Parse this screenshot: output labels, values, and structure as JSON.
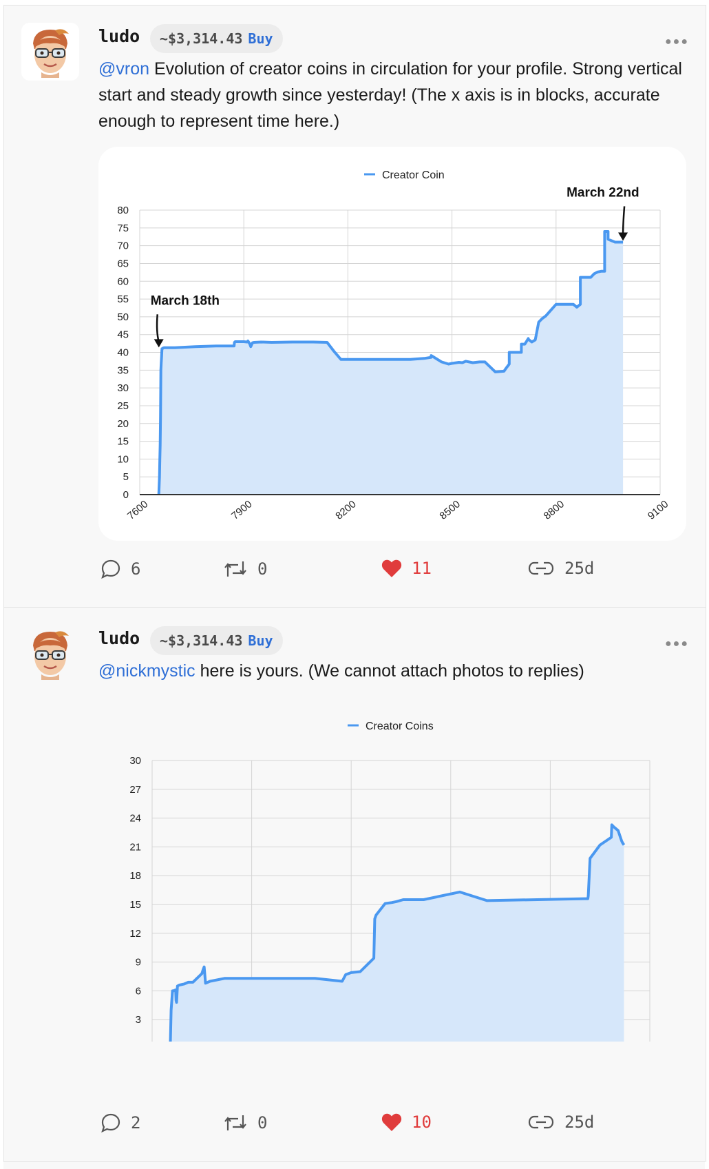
{
  "posts": [
    {
      "username": "ludo",
      "price": "~$3,314.43",
      "buy_label": "Buy",
      "mention": "@vron",
      "text": " Evolution of creator coins in circulation for your profile. Strong vertical start and steady growth since yesterday! (The x axis is in blocks, accurate enough to represent time here.)",
      "actions": {
        "comments": "6",
        "reposts": "0",
        "likes": "11",
        "age": "25d"
      }
    },
    {
      "username": "ludo",
      "price": "~$3,314.43",
      "buy_label": "Buy",
      "mention": "@nickmystic",
      "text": " here is yours. (We cannot attach photos to replies)",
      "actions": {
        "comments": "2",
        "reposts": "0",
        "likes": "10",
        "age": "25d"
      }
    }
  ],
  "colors": {
    "accent": "#2f6fd6",
    "like": "#e03c3c",
    "series": "#4a98f0",
    "fill": "#d6e7fa"
  },
  "chart_data": [
    {
      "type": "area",
      "legend": "Creator Coin",
      "xlim": [
        7600,
        9100
      ],
      "xticks": [
        7600,
        7900,
        8200,
        8500,
        8800,
        9100
      ],
      "ylim": [
        0,
        80
      ],
      "yticks": [
        0,
        5,
        10,
        15,
        20,
        25,
        30,
        35,
        40,
        45,
        50,
        55,
        60,
        65,
        70,
        75,
        80
      ],
      "grid": true,
      "legend_position": "top",
      "annotations": [
        {
          "text": "March 18th",
          "x": 7655,
          "y": 41
        },
        {
          "text": "March 22nd",
          "x": 8993,
          "y": 71
        }
      ],
      "series": [
        {
          "name": "Creator Coin",
          "x": [
            7655,
            7657,
            7658,
            7659,
            7660,
            7661,
            7662,
            7663,
            7664,
            7665,
            7667,
            7670,
            7700,
            7760,
            7820,
            7872,
            7873,
            7875,
            7900,
            7910,
            7912,
            7917,
            7920,
            7925,
            7930,
            7950,
            7980,
            8040,
            8100,
            8140,
            8160,
            8180,
            8200,
            8260,
            8380,
            8420,
            8440,
            8440,
            8470,
            8490,
            8500,
            8520,
            8530,
            8540,
            8560,
            8580,
            8595,
            8625,
            8650,
            8655,
            8665,
            8665,
            8700,
            8700,
            8710,
            8720,
            8720,
            8730,
            8740,
            8750,
            8760,
            8770,
            8770,
            8800,
            8800,
            8850,
            8860,
            8870,
            8870,
            8900,
            8910,
            8920,
            8930,
            8940,
            8940,
            8950,
            8950,
            8970,
            8975,
            8993
          ],
          "y": [
            0,
            5,
            10,
            14,
            22,
            35,
            37,
            39,
            41,
            41,
            41.2,
            41.3,
            41.3,
            41.6,
            41.8,
            41.8,
            42.8,
            43,
            43,
            42.9,
            43.2,
            42.4,
            41.6,
            42.7,
            42.8,
            42.9,
            42.8,
            42.9,
            42.9,
            42.8,
            40.3,
            38,
            38,
            38,
            38,
            38.3,
            38.6,
            39.1,
            37.3,
            36.7,
            36.9,
            37.2,
            37.1,
            37.5,
            37.1,
            37.3,
            37.3,
            34.5,
            34.7,
            35.4,
            36.7,
            40,
            40,
            42.3,
            42.3,
            43.9,
            43.7,
            42.9,
            43.5,
            48.5,
            49.5,
            50.2,
            50.2,
            53.5,
            53.5,
            53.5,
            52.7,
            53.5,
            61.1,
            61.1,
            62.1,
            62.6,
            62.8,
            62.8,
            74,
            74,
            71.8,
            71,
            71,
            71
          ]
        }
      ]
    },
    {
      "type": "area",
      "legend": "Creator Coins",
      "xlim": [
        8000,
        9100
      ],
      "xticks": [
        8000,
        8220,
        8440,
        8660,
        8880,
        9100
      ],
      "ylim": [
        0,
        30
      ],
      "yticks": [
        0,
        3,
        6,
        9,
        12,
        15,
        18,
        21,
        24,
        27,
        30
      ],
      "grid": true,
      "legend_position": "top",
      "series": [
        {
          "name": "Creator Coins",
          "x": [
            8040,
            8042,
            8045,
            8047,
            8052,
            8053,
            8054,
            8056,
            8060,
            8070,
            8080,
            8090,
            8110,
            8112,
            8115,
            8118,
            8128,
            8160,
            8270,
            8360,
            8420,
            8428,
            8440,
            8460,
            8490,
            8492,
            8495,
            8515,
            8530,
            8540,
            8555,
            8600,
            8680,
            8740,
            8955,
            8963,
            8964,
            8968,
            8990,
            9015,
            9016,
            9020,
            9030,
            9035,
            9038,
            9040,
            9043
          ],
          "y": [
            0,
            4,
            6,
            6,
            6.1,
            5.0,
            4.8,
            6.5,
            6.6,
            6.7,
            6.9,
            6.9,
            7.8,
            8.1,
            8.5,
            6.8,
            7.0,
            7.3,
            7.3,
            7.3,
            7.0,
            7.7,
            7.9,
            8.0,
            9.4,
            13.5,
            13.9,
            15.1,
            15.2,
            15.3,
            15.5,
            15.5,
            16.3,
            15.4,
            15.6,
            15.6,
            15.9,
            19.8,
            21.2,
            22.0,
            23.3,
            23.1,
            22.7,
            22.0,
            21.6,
            21.4,
            21.2
          ]
        }
      ]
    }
  ]
}
